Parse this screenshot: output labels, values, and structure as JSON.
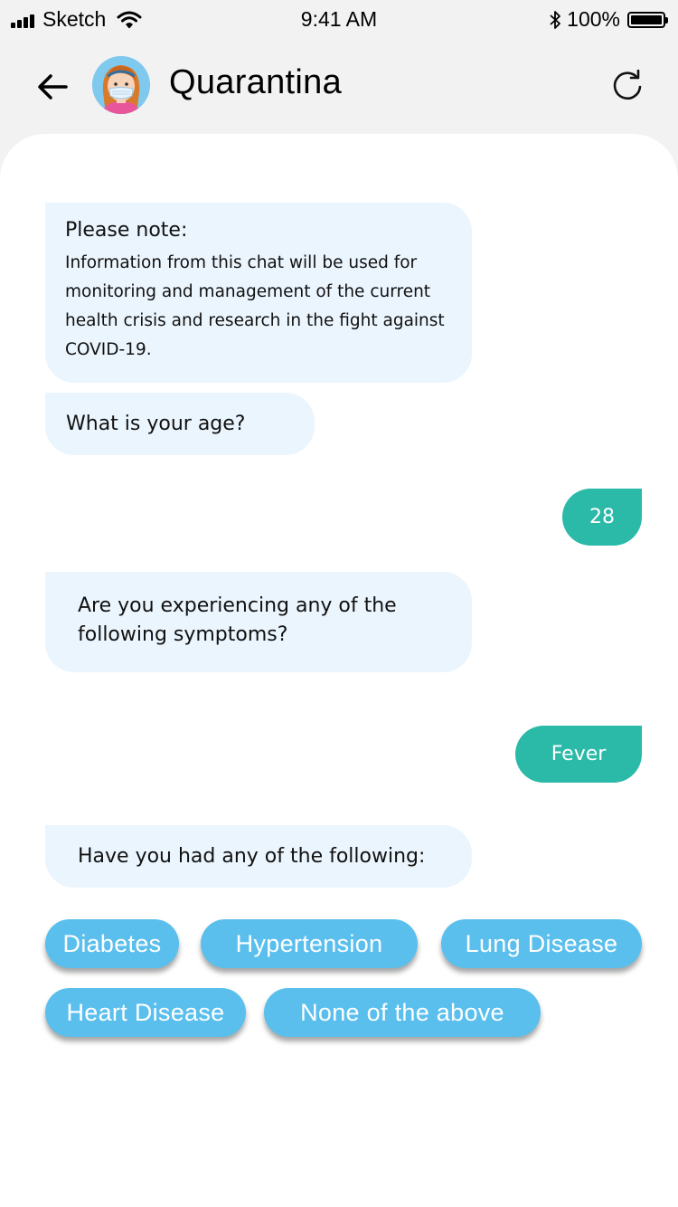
{
  "status_bar": {
    "carrier": "Sketch",
    "time": "9:41 AM",
    "battery": "100%",
    "icons": [
      "signal-icon",
      "wifi-icon",
      "bluetooth-icon",
      "battery-icon"
    ]
  },
  "header": {
    "bot_name": "Quarantina",
    "icons": [
      "back-arrow-icon",
      "avatar",
      "refresh-icon"
    ]
  },
  "messages": {
    "note_title": "Please note:",
    "note_body": "Information from this chat will be used for monitoring and management of the current health crisis and research in the fight against COVID-19.",
    "age_question": "What is your age?",
    "age_answer": "28",
    "symptoms_question": "Are you experiencing any of the following symptoms?",
    "symptoms_answer": "Fever",
    "history_question": "Have you had any of the following:"
  },
  "options": [
    "Diabetes",
    "Hypertension",
    "Lung Disease",
    "Heart Disease",
    "None of the above"
  ],
  "colors": {
    "bot_bubble": "#ebf5fd",
    "user_bubble": "#2bb9a8",
    "chip": "#5abfec",
    "header_bg": "#f2f2f2"
  }
}
